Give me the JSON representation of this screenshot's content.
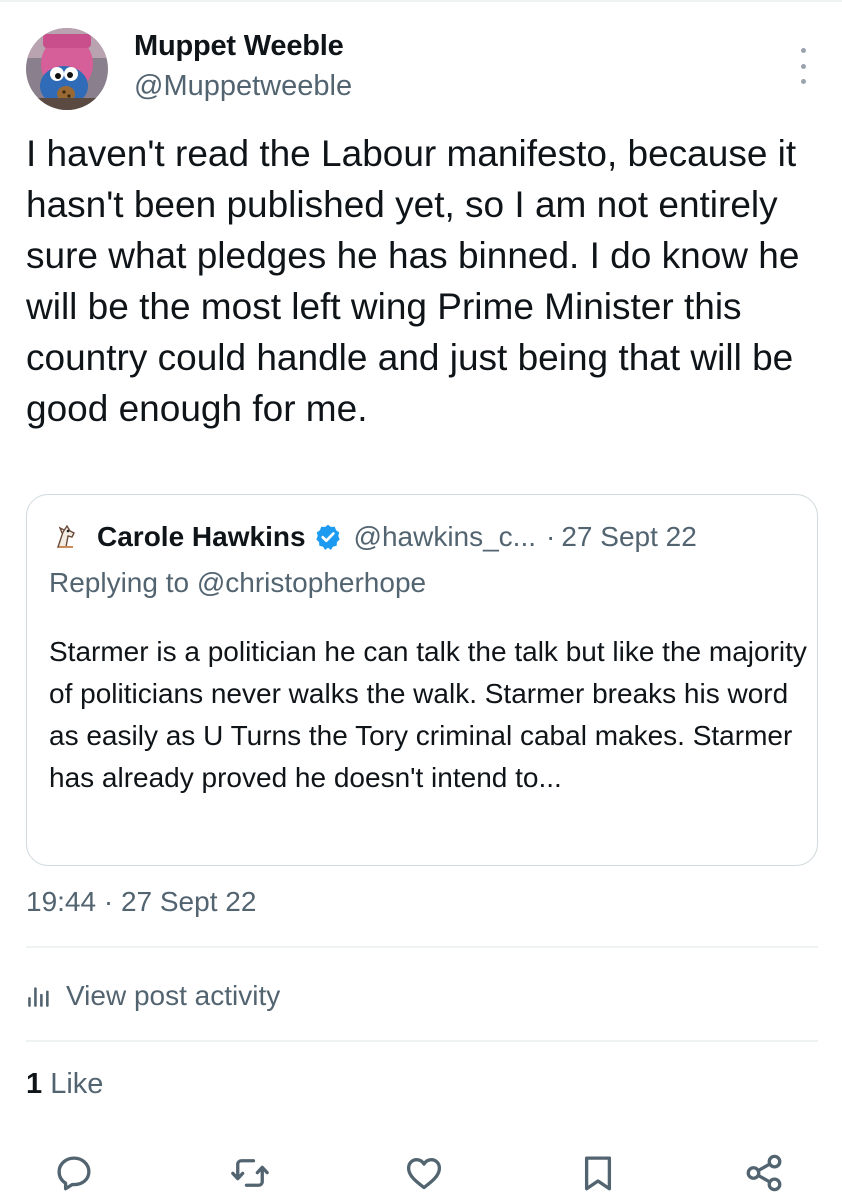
{
  "post": {
    "author_name": "Muppet Weeble",
    "author_handle": "@Muppetweeble",
    "text": "I haven't read the Labour manifesto, because it hasn't been published yet, so I am not entirely sure what pledges he has binned. I do know he will be the most left wing Prime Minister this country could handle and just being that will be good enough for me.",
    "timestamp": "19:44 · 27 Sept 22"
  },
  "quote": {
    "author_name": "Carole Hawkins",
    "author_handle": "@hawkins_c...",
    "separator": "·",
    "date": "27 Sept 22",
    "replying_to": "Replying to @christopherhope",
    "text": "Starmer is a politician he can talk the talk but like the majority of politicians never walks the walk. Starmer breaks his word as easily as U Turns the Tory criminal cabal makes. Starmer has already proved he doesn't intend to..."
  },
  "activity": {
    "label": "View post activity"
  },
  "engagement": {
    "like_count": "1",
    "like_label": "Like"
  },
  "actions": [
    "reply-icon",
    "repost-icon",
    "like-icon",
    "bookmark-icon",
    "share-icon"
  ],
  "colors": {
    "text": "#0f1419",
    "secondary": "#536471",
    "border": "#cfd9de",
    "divider": "#eff3f4",
    "verified": "#1d9bf0"
  }
}
